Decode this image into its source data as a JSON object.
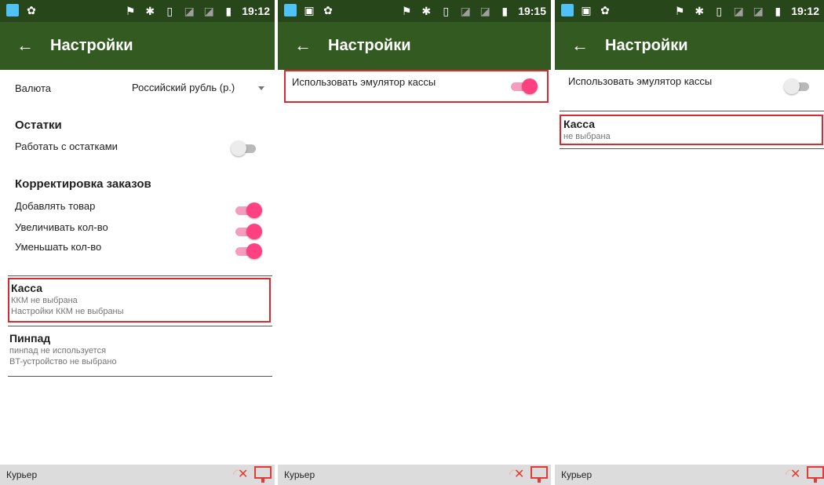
{
  "common": {
    "app_title": "Настройки",
    "back_icon": "←",
    "bottom_label": "Курьер",
    "status_icons": {
      "notification_app": "📶",
      "android_icon": "☃",
      "location_icon": "⚲",
      "bluetooth_icon": "✱",
      "vibrate_icon": "▯",
      "signal_icon": "⋈",
      "battery_icon": "▮"
    },
    "colors": {
      "statusbar": "#27471a",
      "appbar": "#325a21",
      "toggle_on": "#ff4081",
      "highlight": "#d92b2f"
    }
  },
  "screens": [
    {
      "time": "19:12",
      "currency": {
        "label": "Валюта",
        "value": "Российский рубль (р.)"
      },
      "stock": {
        "title": "Остатки",
        "label": "Работать с остатками",
        "enabled": false
      },
      "orders": {
        "title": "Корректировка заказов",
        "items": [
          {
            "label": "Добавлять товар",
            "enabled": true
          },
          {
            "label": "Увеличивать кол-во",
            "enabled": true
          },
          {
            "label": "Уменьшать кол-во",
            "enabled": true
          }
        ]
      },
      "kassa": {
        "title": "Касса",
        "line1": "ККМ не выбрана",
        "line2": "Настройки ККМ не выбраны"
      },
      "pinpad": {
        "title": "Пинпад",
        "line1": "пинпад не используется",
        "line2": "BT-устройство не выбрано"
      }
    },
    {
      "time": "19:15",
      "emulator": {
        "label": "Использовать эмулятор кассы",
        "enabled": true
      }
    },
    {
      "time": "19:12",
      "emulator": {
        "label": "Использовать эмулятор кассы",
        "enabled": false
      },
      "kassa": {
        "title": "Касса",
        "line1": "не выбрана"
      }
    }
  ]
}
